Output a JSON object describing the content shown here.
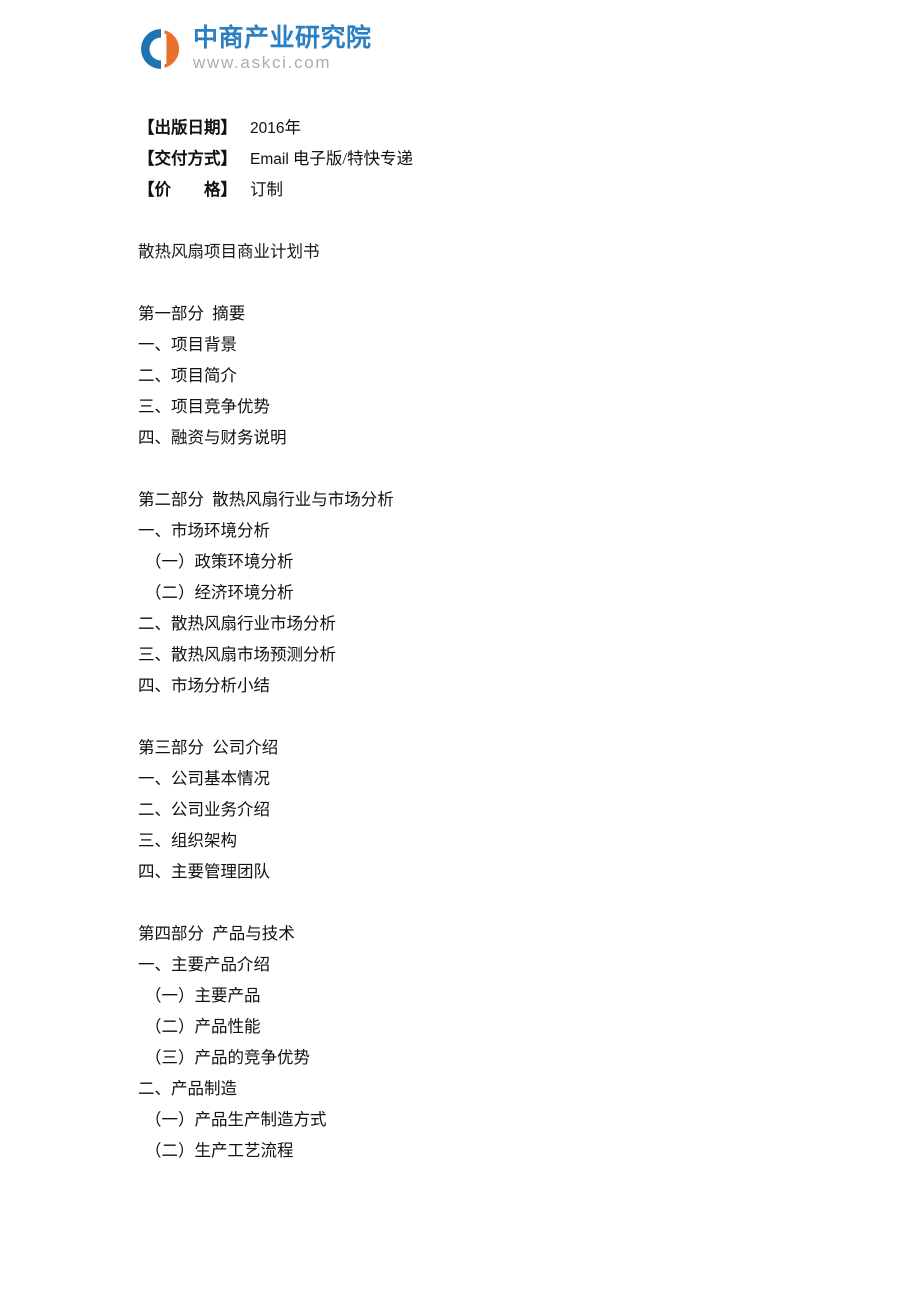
{
  "logo": {
    "name": "中商产业研究院",
    "url": "www.askci.com",
    "brand_blue": "#2b7fc3",
    "brand_orange": "#e8722c",
    "url_gray": "#adadad"
  },
  "meta": {
    "publish_date_label": "【出版日期】",
    "publish_date_value_latin": "2016",
    "publish_date_value_cjk": "年",
    "delivery_label": "【交付方式】",
    "delivery_value_latin": "Email",
    "delivery_value_cjk": "电子版/特快专递",
    "price_label": "【价　　格】",
    "price_value": "订制"
  },
  "document": {
    "title": "散热风扇项目商业计划书",
    "parts": [
      {
        "heading": "第一部分  摘要",
        "items": [
          {
            "text": "一、项目背景",
            "level": 1
          },
          {
            "text": "二、项目简介",
            "level": 1
          },
          {
            "text": "三、项目竞争优势",
            "level": 1
          },
          {
            "text": "四、融资与财务说明",
            "level": 1
          }
        ]
      },
      {
        "heading": "第二部分  散热风扇行业与市场分析",
        "items": [
          {
            "text": "一、市场环境分析",
            "level": 1
          },
          {
            "text": "（一）政策环境分析",
            "level": 2
          },
          {
            "text": "（二）经济环境分析",
            "level": 2
          },
          {
            "text": "二、散热风扇行业市场分析",
            "level": 1
          },
          {
            "text": "三、散热风扇市场预测分析",
            "level": 1
          },
          {
            "text": "四、市场分析小结",
            "level": 1
          }
        ]
      },
      {
        "heading": "第三部分  公司介绍",
        "items": [
          {
            "text": "一、公司基本情况",
            "level": 1
          },
          {
            "text": "二、公司业务介绍",
            "level": 1
          },
          {
            "text": "三、组织架构",
            "level": 1
          },
          {
            "text": "四、主要管理团队",
            "level": 1
          }
        ]
      },
      {
        "heading": "第四部分  产品与技术",
        "items": [
          {
            "text": "一、主要产品介绍",
            "level": 1
          },
          {
            "text": "（一）主要产品",
            "level": 2
          },
          {
            "text": "（二）产品性能",
            "level": 2
          },
          {
            "text": "（三）产品的竞争优势",
            "level": 2
          },
          {
            "text": "二、产品制造",
            "level": 1
          },
          {
            "text": "（一）产品生产制造方式",
            "level": 2
          },
          {
            "text": "（二）生产工艺流程",
            "level": 2
          }
        ]
      }
    ]
  }
}
